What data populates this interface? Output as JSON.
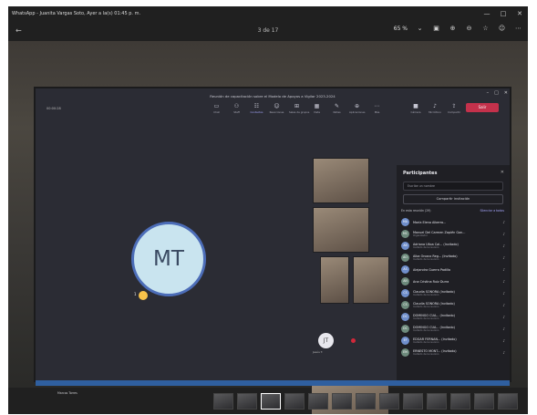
{
  "window": {
    "title": "WhatsApp - Juanita Vargas Soto, Ayer a la(s) 01:45 p. m.",
    "controls": {
      "minimize": "—",
      "maximize": "□",
      "close": "✕"
    }
  },
  "toolbar": {
    "counter": "3 de 17",
    "zoom": "65 %",
    "icons": [
      "back-arrow-icon",
      "fit-screen-icon",
      "zoom-in-icon",
      "zoom-out-icon",
      "star-icon",
      "emoji-icon",
      "more-icon"
    ]
  },
  "teams": {
    "meeting_title": "Reunión de capacitación sobre el Modelo de Apoyos a Vigilar 2023-2024",
    "timer": "00:00:28",
    "toolbar_items": [
      {
        "label": "Chat",
        "icon": "chat-icon"
      },
      {
        "label": "Staff",
        "icon": "people-icon"
      },
      {
        "label": "Contactos",
        "icon": "contacts-icon"
      },
      {
        "label": "Reacciones",
        "icon": "reactions-icon"
      },
      {
        "label": "Salas de grupos",
        "icon": "rooms-icon"
      },
      {
        "label": "Vista",
        "icon": "view-icon"
      },
      {
        "label": "Notas",
        "icon": "notes-icon"
      },
      {
        "label": "Aplicaciones",
        "icon": "apps-icon"
      },
      {
        "label": "Más",
        "icon": "more-icon"
      }
    ],
    "call_controls": [
      {
        "label": "Cámara",
        "icon": "camera-icon"
      },
      {
        "label": "Micrófono",
        "icon": "mic-icon"
      },
      {
        "label": "Compartir",
        "icon": "share-icon"
      }
    ],
    "leave_label": "Salir",
    "stage": {
      "avatar_initials": "MT",
      "hand_count": "1",
      "presenter_name": "Marcos Torres"
    },
    "jt_initials": "JT",
    "jt_name": "Jesús T.",
    "panel": {
      "title": "Participantes",
      "search_placeholder": "Escribe un nombre",
      "share_invite": "Compartir invitación",
      "section_label": "En esta reunión (29)",
      "mute_all": "Silenciar a todos",
      "participants": [
        {
          "initials": "MA",
          "name": "María Elena Alberro...",
          "role": ""
        },
        {
          "initials": "MC",
          "name": "Manuel Del Carmen Zapién Gon...",
          "role": "Organizador"
        },
        {
          "initials": "AB",
          "name": "Adriana Ulloa Cal... (Invitado)",
          "role": "Invitado de la reunión"
        },
        {
          "initials": "AO",
          "name": "Alba Orozco Reg... (Invitado)",
          "role": "Invitado de la reunión"
        },
        {
          "initials": "AS",
          "name": "Alejandra Guerra Padilla",
          "role": ""
        },
        {
          "initials": "AN",
          "name": "Ana Cristina Ruiz Durra",
          "role": ""
        },
        {
          "initials": "CS",
          "name": "Claudia SONORA (Invitado)",
          "role": "Invitado de la reunión"
        },
        {
          "initials": "CS",
          "name": "Claudia SONORA (Invitado)",
          "role": "Invitado de la reunión"
        },
        {
          "initials": "DC",
          "name": "DOMINGO CUA... (Invitado)",
          "role": "Invitado de la reunión"
        },
        {
          "initials": "DC",
          "name": "DOMINGO CUA... (Invitado)",
          "role": "Invitado de la reunión"
        },
        {
          "initials": "EF",
          "name": "EDGAR FERNAN... (Invitado)",
          "role": "Invitado de la reunión"
        },
        {
          "initials": "EM",
          "name": "ERNESTO MONT... (Invitado)",
          "role": "Invitado de la reunión"
        }
      ]
    }
  },
  "filmstrip": {
    "count": 13,
    "active_index": 2
  }
}
